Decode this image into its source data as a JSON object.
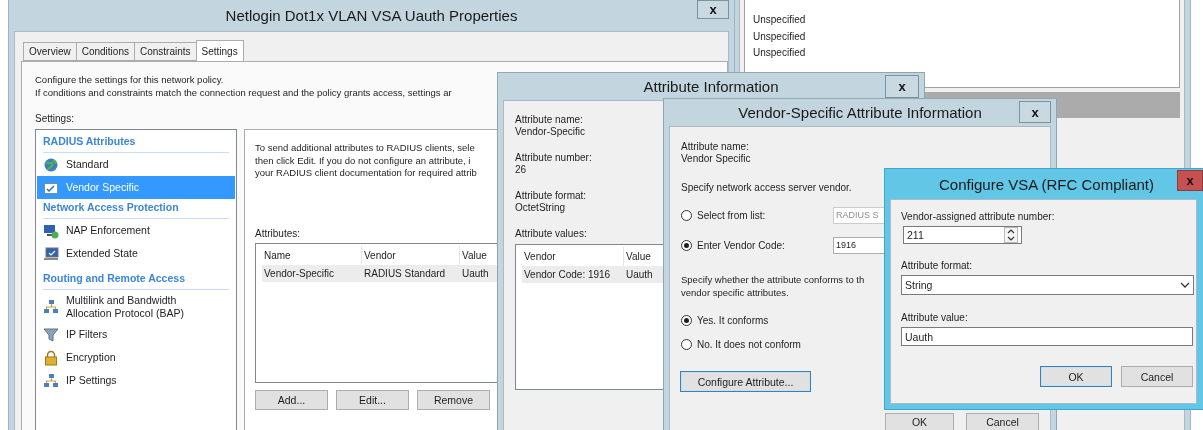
{
  "background_window": {
    "list_items": [
      "Unspecified",
      "Unspecified",
      "Unspecified"
    ]
  },
  "properties_window": {
    "title": "Netlogin Dot1x VLAN VSA Uauth Properties",
    "close_label": "x",
    "tabs": [
      {
        "label": "Overview",
        "selected": false
      },
      {
        "label": "Conditions",
        "selected": false
      },
      {
        "label": "Constraints",
        "selected": false
      },
      {
        "label": "Settings",
        "selected": true
      }
    ],
    "intro_lines": [
      "Configure the settings for this network policy.",
      "If conditions and constraints match the connection request and the policy grants access, settings ar"
    ],
    "settings_label": "Settings:",
    "settings_sections": [
      {
        "heading": "RADIUS Attributes",
        "items": [
          {
            "label": "Standard",
            "selected": false
          },
          {
            "label": "Vendor Specific",
            "selected": true
          }
        ]
      },
      {
        "heading": "Network Access Protection",
        "items": [
          {
            "label": "NAP Enforcement",
            "selected": false
          },
          {
            "label": "Extended State",
            "selected": false
          }
        ]
      },
      {
        "heading": "Routing and Remote Access",
        "items": [
          {
            "label": "Multilink and Bandwidth Allocation Protocol (BAP)",
            "selected": false
          },
          {
            "label": "IP Filters",
            "selected": false
          },
          {
            "label": "Encryption",
            "selected": false
          },
          {
            "label": "IP Settings",
            "selected": false
          }
        ]
      }
    ],
    "description_lines": [
      "To send additional attributes to RADIUS clients, sele",
      "then click Edit. If you do not configure an attribute, i",
      "your RADIUS client documentation for required attrib"
    ],
    "attributes_label": "Attributes:",
    "attributes_table": {
      "columns": [
        "Name",
        "Vendor",
        "Value"
      ],
      "rows": [
        {
          "cells": [
            "Vendor-Specific",
            "RADIUS Standard",
            "Uauth"
          ],
          "selected": true
        }
      ]
    },
    "buttons": [
      {
        "label": "Add...",
        "default": false
      },
      {
        "label": "Edit...",
        "default": false
      },
      {
        "label": "Remove",
        "default": false
      }
    ]
  },
  "attribute_info_window": {
    "title": "Attribute Information",
    "close_label": "x",
    "fields": [
      {
        "label": "Attribute name:",
        "value": "Vendor-Specific"
      },
      {
        "label": "Attribute number:",
        "value": "26"
      },
      {
        "label": "Attribute format:",
        "value": "OctetString"
      }
    ],
    "values_label": "Attribute values:",
    "values_table": {
      "columns": [
        "Vendor",
        "Value"
      ],
      "rows": [
        {
          "cells": [
            "Vendor Code: 1916",
            "Uauth"
          ],
          "selected": true
        }
      ]
    }
  },
  "vsa_info_window": {
    "title": "Vendor-Specific Attribute Information",
    "close_label": "x",
    "name_label": "Attribute name:",
    "name_value": "Vendor Specific",
    "vendor_prompt": "Specify network access server vendor.",
    "vendor_options": [
      {
        "label": "Select from list:",
        "selected": false,
        "field": "RADIUS S",
        "disabled": true
      },
      {
        "label": "Enter Vendor Code:",
        "selected": true,
        "field": "1916",
        "disabled": false
      }
    ],
    "conform_prompt_lines": [
      "Specify whether the attribute conforms to th",
      "vendor specific attributes."
    ],
    "conform_options": [
      {
        "label": "Yes. It conforms",
        "selected": true
      },
      {
        "label": "No. It does not conform",
        "selected": false
      }
    ],
    "configure_button": {
      "label": "Configure Attribute...",
      "default": true
    },
    "buttons": [
      {
        "label": "OK",
        "default": false
      },
      {
        "label": "Cancel",
        "default": false
      }
    ]
  },
  "configure_vsa_window": {
    "title": "Configure VSA (RFC Compliant)",
    "close_label": "x",
    "number_label": "Vendor-assigned attribute number:",
    "number_value": "211",
    "format_label": "Attribute format:",
    "format_value": "String",
    "value_label": "Attribute value:",
    "value_value": "Uauth",
    "buttons": [
      {
        "label": "OK",
        "default": true
      },
      {
        "label": "Cancel",
        "default": false
      }
    ]
  }
}
